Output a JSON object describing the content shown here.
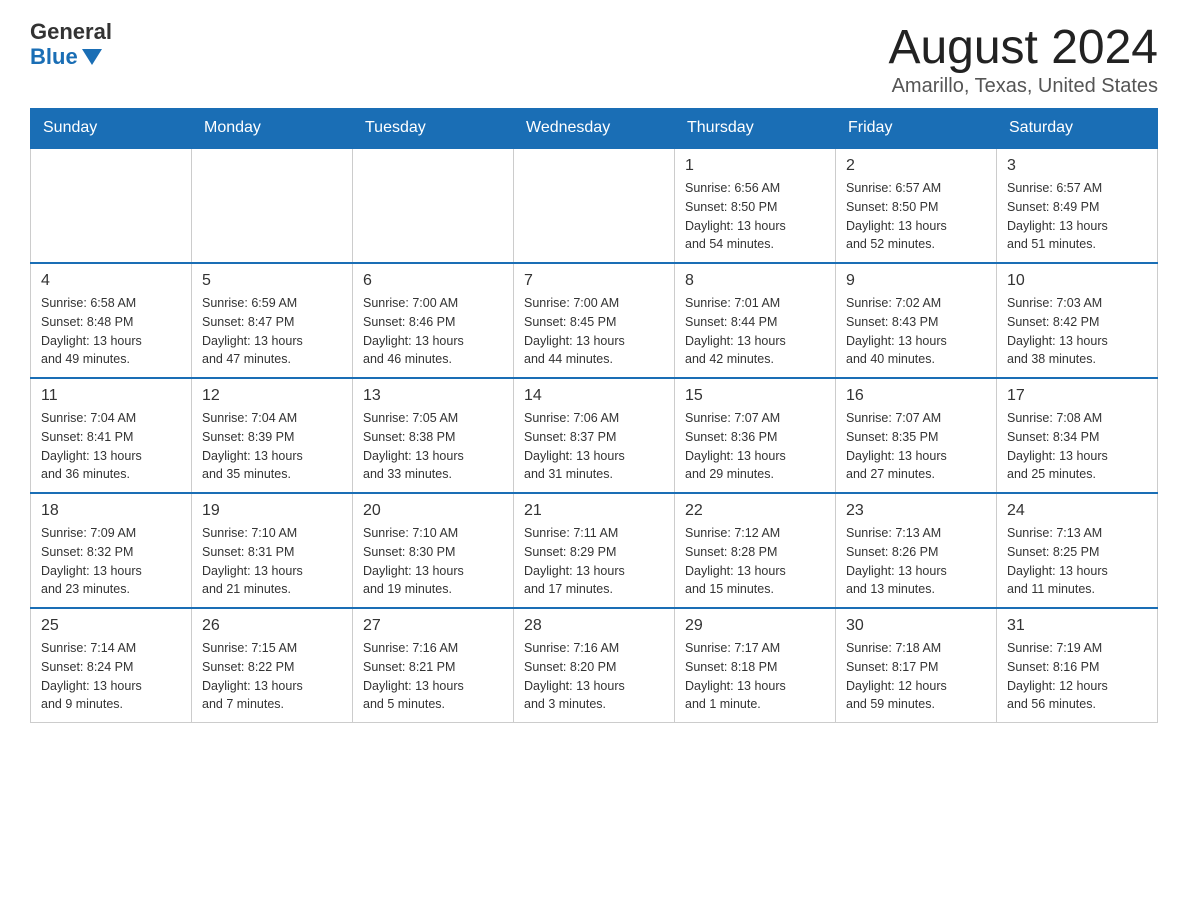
{
  "logo": {
    "general": "General",
    "blue": "Blue"
  },
  "title": "August 2024",
  "subtitle": "Amarillo, Texas, United States",
  "days_of_week": [
    "Sunday",
    "Monday",
    "Tuesday",
    "Wednesday",
    "Thursday",
    "Friday",
    "Saturday"
  ],
  "weeks": [
    [
      {
        "day": "",
        "info": ""
      },
      {
        "day": "",
        "info": ""
      },
      {
        "day": "",
        "info": ""
      },
      {
        "day": "",
        "info": ""
      },
      {
        "day": "1",
        "info": "Sunrise: 6:56 AM\nSunset: 8:50 PM\nDaylight: 13 hours\nand 54 minutes."
      },
      {
        "day": "2",
        "info": "Sunrise: 6:57 AM\nSunset: 8:50 PM\nDaylight: 13 hours\nand 52 minutes."
      },
      {
        "day": "3",
        "info": "Sunrise: 6:57 AM\nSunset: 8:49 PM\nDaylight: 13 hours\nand 51 minutes."
      }
    ],
    [
      {
        "day": "4",
        "info": "Sunrise: 6:58 AM\nSunset: 8:48 PM\nDaylight: 13 hours\nand 49 minutes."
      },
      {
        "day": "5",
        "info": "Sunrise: 6:59 AM\nSunset: 8:47 PM\nDaylight: 13 hours\nand 47 minutes."
      },
      {
        "day": "6",
        "info": "Sunrise: 7:00 AM\nSunset: 8:46 PM\nDaylight: 13 hours\nand 46 minutes."
      },
      {
        "day": "7",
        "info": "Sunrise: 7:00 AM\nSunset: 8:45 PM\nDaylight: 13 hours\nand 44 minutes."
      },
      {
        "day": "8",
        "info": "Sunrise: 7:01 AM\nSunset: 8:44 PM\nDaylight: 13 hours\nand 42 minutes."
      },
      {
        "day": "9",
        "info": "Sunrise: 7:02 AM\nSunset: 8:43 PM\nDaylight: 13 hours\nand 40 minutes."
      },
      {
        "day": "10",
        "info": "Sunrise: 7:03 AM\nSunset: 8:42 PM\nDaylight: 13 hours\nand 38 minutes."
      }
    ],
    [
      {
        "day": "11",
        "info": "Sunrise: 7:04 AM\nSunset: 8:41 PM\nDaylight: 13 hours\nand 36 minutes."
      },
      {
        "day": "12",
        "info": "Sunrise: 7:04 AM\nSunset: 8:39 PM\nDaylight: 13 hours\nand 35 minutes."
      },
      {
        "day": "13",
        "info": "Sunrise: 7:05 AM\nSunset: 8:38 PM\nDaylight: 13 hours\nand 33 minutes."
      },
      {
        "day": "14",
        "info": "Sunrise: 7:06 AM\nSunset: 8:37 PM\nDaylight: 13 hours\nand 31 minutes."
      },
      {
        "day": "15",
        "info": "Sunrise: 7:07 AM\nSunset: 8:36 PM\nDaylight: 13 hours\nand 29 minutes."
      },
      {
        "day": "16",
        "info": "Sunrise: 7:07 AM\nSunset: 8:35 PM\nDaylight: 13 hours\nand 27 minutes."
      },
      {
        "day": "17",
        "info": "Sunrise: 7:08 AM\nSunset: 8:34 PM\nDaylight: 13 hours\nand 25 minutes."
      }
    ],
    [
      {
        "day": "18",
        "info": "Sunrise: 7:09 AM\nSunset: 8:32 PM\nDaylight: 13 hours\nand 23 minutes."
      },
      {
        "day": "19",
        "info": "Sunrise: 7:10 AM\nSunset: 8:31 PM\nDaylight: 13 hours\nand 21 minutes."
      },
      {
        "day": "20",
        "info": "Sunrise: 7:10 AM\nSunset: 8:30 PM\nDaylight: 13 hours\nand 19 minutes."
      },
      {
        "day": "21",
        "info": "Sunrise: 7:11 AM\nSunset: 8:29 PM\nDaylight: 13 hours\nand 17 minutes."
      },
      {
        "day": "22",
        "info": "Sunrise: 7:12 AM\nSunset: 8:28 PM\nDaylight: 13 hours\nand 15 minutes."
      },
      {
        "day": "23",
        "info": "Sunrise: 7:13 AM\nSunset: 8:26 PM\nDaylight: 13 hours\nand 13 minutes."
      },
      {
        "day": "24",
        "info": "Sunrise: 7:13 AM\nSunset: 8:25 PM\nDaylight: 13 hours\nand 11 minutes."
      }
    ],
    [
      {
        "day": "25",
        "info": "Sunrise: 7:14 AM\nSunset: 8:24 PM\nDaylight: 13 hours\nand 9 minutes."
      },
      {
        "day": "26",
        "info": "Sunrise: 7:15 AM\nSunset: 8:22 PM\nDaylight: 13 hours\nand 7 minutes."
      },
      {
        "day": "27",
        "info": "Sunrise: 7:16 AM\nSunset: 8:21 PM\nDaylight: 13 hours\nand 5 minutes."
      },
      {
        "day": "28",
        "info": "Sunrise: 7:16 AM\nSunset: 8:20 PM\nDaylight: 13 hours\nand 3 minutes."
      },
      {
        "day": "29",
        "info": "Sunrise: 7:17 AM\nSunset: 8:18 PM\nDaylight: 13 hours\nand 1 minute."
      },
      {
        "day": "30",
        "info": "Sunrise: 7:18 AM\nSunset: 8:17 PM\nDaylight: 12 hours\nand 59 minutes."
      },
      {
        "day": "31",
        "info": "Sunrise: 7:19 AM\nSunset: 8:16 PM\nDaylight: 12 hours\nand 56 minutes."
      }
    ]
  ]
}
